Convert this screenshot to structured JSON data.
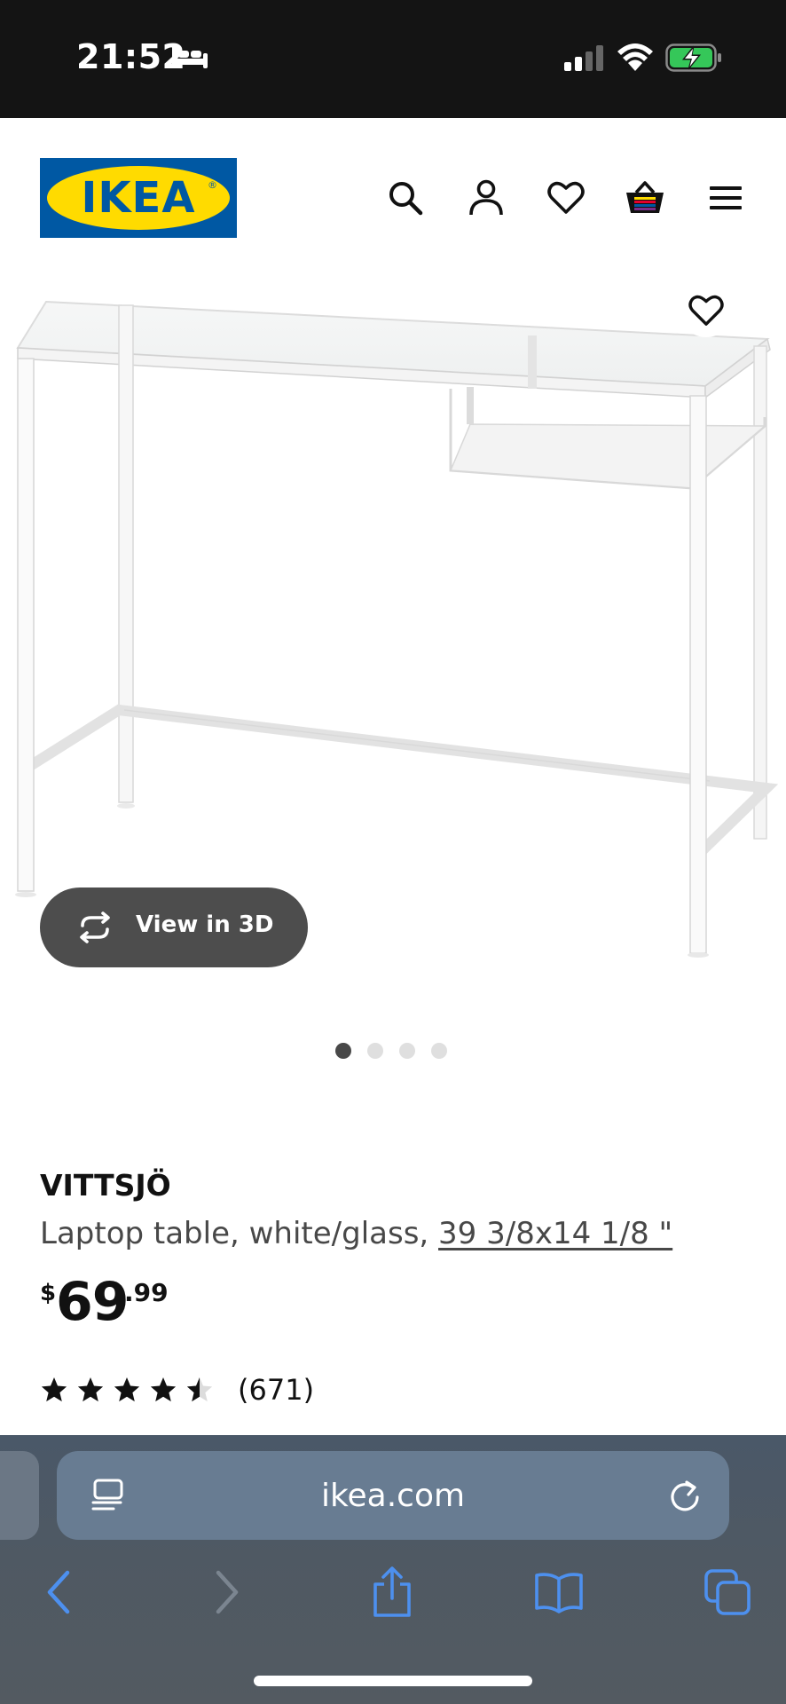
{
  "status_bar": {
    "time": "21:52",
    "icons": [
      "bed-icon",
      "signal-icon",
      "wifi-icon",
      "battery-charging-icon"
    ]
  },
  "header": {
    "logo_text": "IKEA",
    "logo_mark": "®",
    "icons": [
      "search-icon",
      "account-icon",
      "favorites-heart-icon",
      "shopping-bag-icon",
      "menu-icon"
    ],
    "brand_colors": {
      "blue": "#0058a3",
      "yellow": "#ffdb00"
    }
  },
  "gallery": {
    "view_3d_label": "View in 3D",
    "image_count": 4,
    "active_index": 0
  },
  "product": {
    "name": "VITTSJÖ",
    "description": "Laptop table, white/glass, ",
    "dimensions": "39 3/8x14 1/8 \"",
    "price": {
      "currency": "$",
      "integer": "69",
      "decimal": ".99"
    },
    "rating": {
      "stars": 4.5,
      "max": 5,
      "count_label": "(671)"
    }
  },
  "browser": {
    "url": "ikea.com",
    "toolbar_icons": [
      "back-icon",
      "forward-icon",
      "share-icon",
      "bookmarks-icon",
      "tabs-icon"
    ]
  }
}
